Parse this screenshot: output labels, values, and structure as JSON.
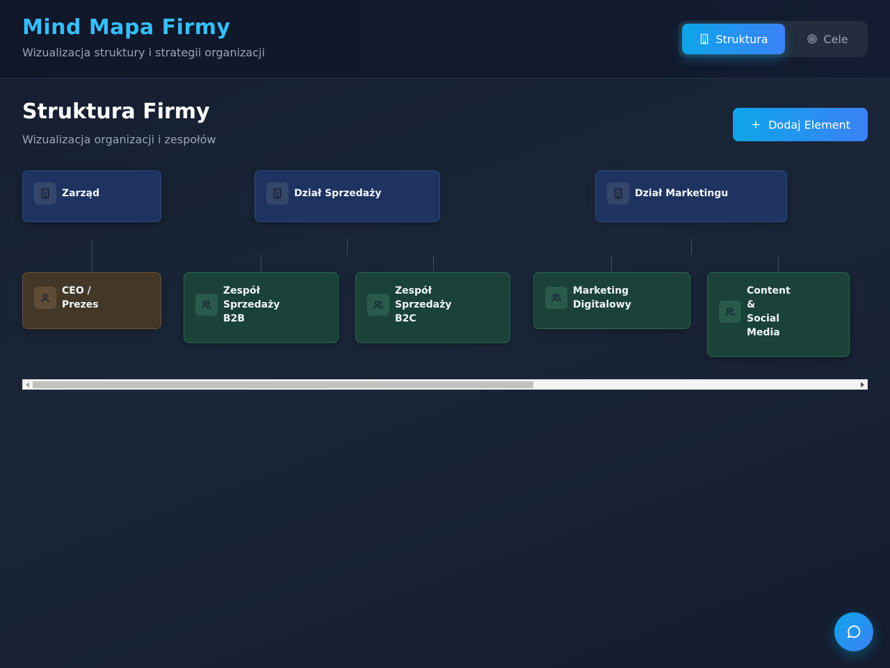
{
  "header": {
    "title": "Mind Mapa Firmy",
    "subtitle": "Wizualizacja struktury i strategii organizacji",
    "tabs": [
      {
        "label": "Struktura",
        "icon": "building-icon",
        "active": true
      },
      {
        "label": "Cele",
        "icon": "target-icon",
        "active": false
      }
    ]
  },
  "section": {
    "title": "Struktura Firmy",
    "subtitle": "Wizualizacja organizacji i zespołów",
    "add_label": "Dodaj Element"
  },
  "nodes": {
    "zarzad": {
      "label": "Zarząd",
      "icon": "building-icon"
    },
    "sprzedaz": {
      "label": "Dział Sprzedaży",
      "icon": "building-icon"
    },
    "marketing": {
      "label": "Dział Marketingu",
      "icon": "building-icon"
    },
    "ceo": {
      "label": "CEO /\nPrezes",
      "icon": "user-icon"
    },
    "b2b": {
      "label": "Zespół\nSprzedaży\nB2B",
      "icon": "users-icon"
    },
    "b2c": {
      "label": "Zespół\nSprzedaży\nB2C",
      "icon": "users-icon"
    },
    "digital": {
      "label": "Marketing\nDigitalowy",
      "icon": "users-icon"
    },
    "content": {
      "label": "Content\n&\nSocial\nMedia",
      "icon": "users-icon"
    }
  },
  "colors": {
    "accent": "#38bdf8",
    "department": "#1e3360",
    "leadership": "#433728",
    "team": "#1b4238"
  }
}
